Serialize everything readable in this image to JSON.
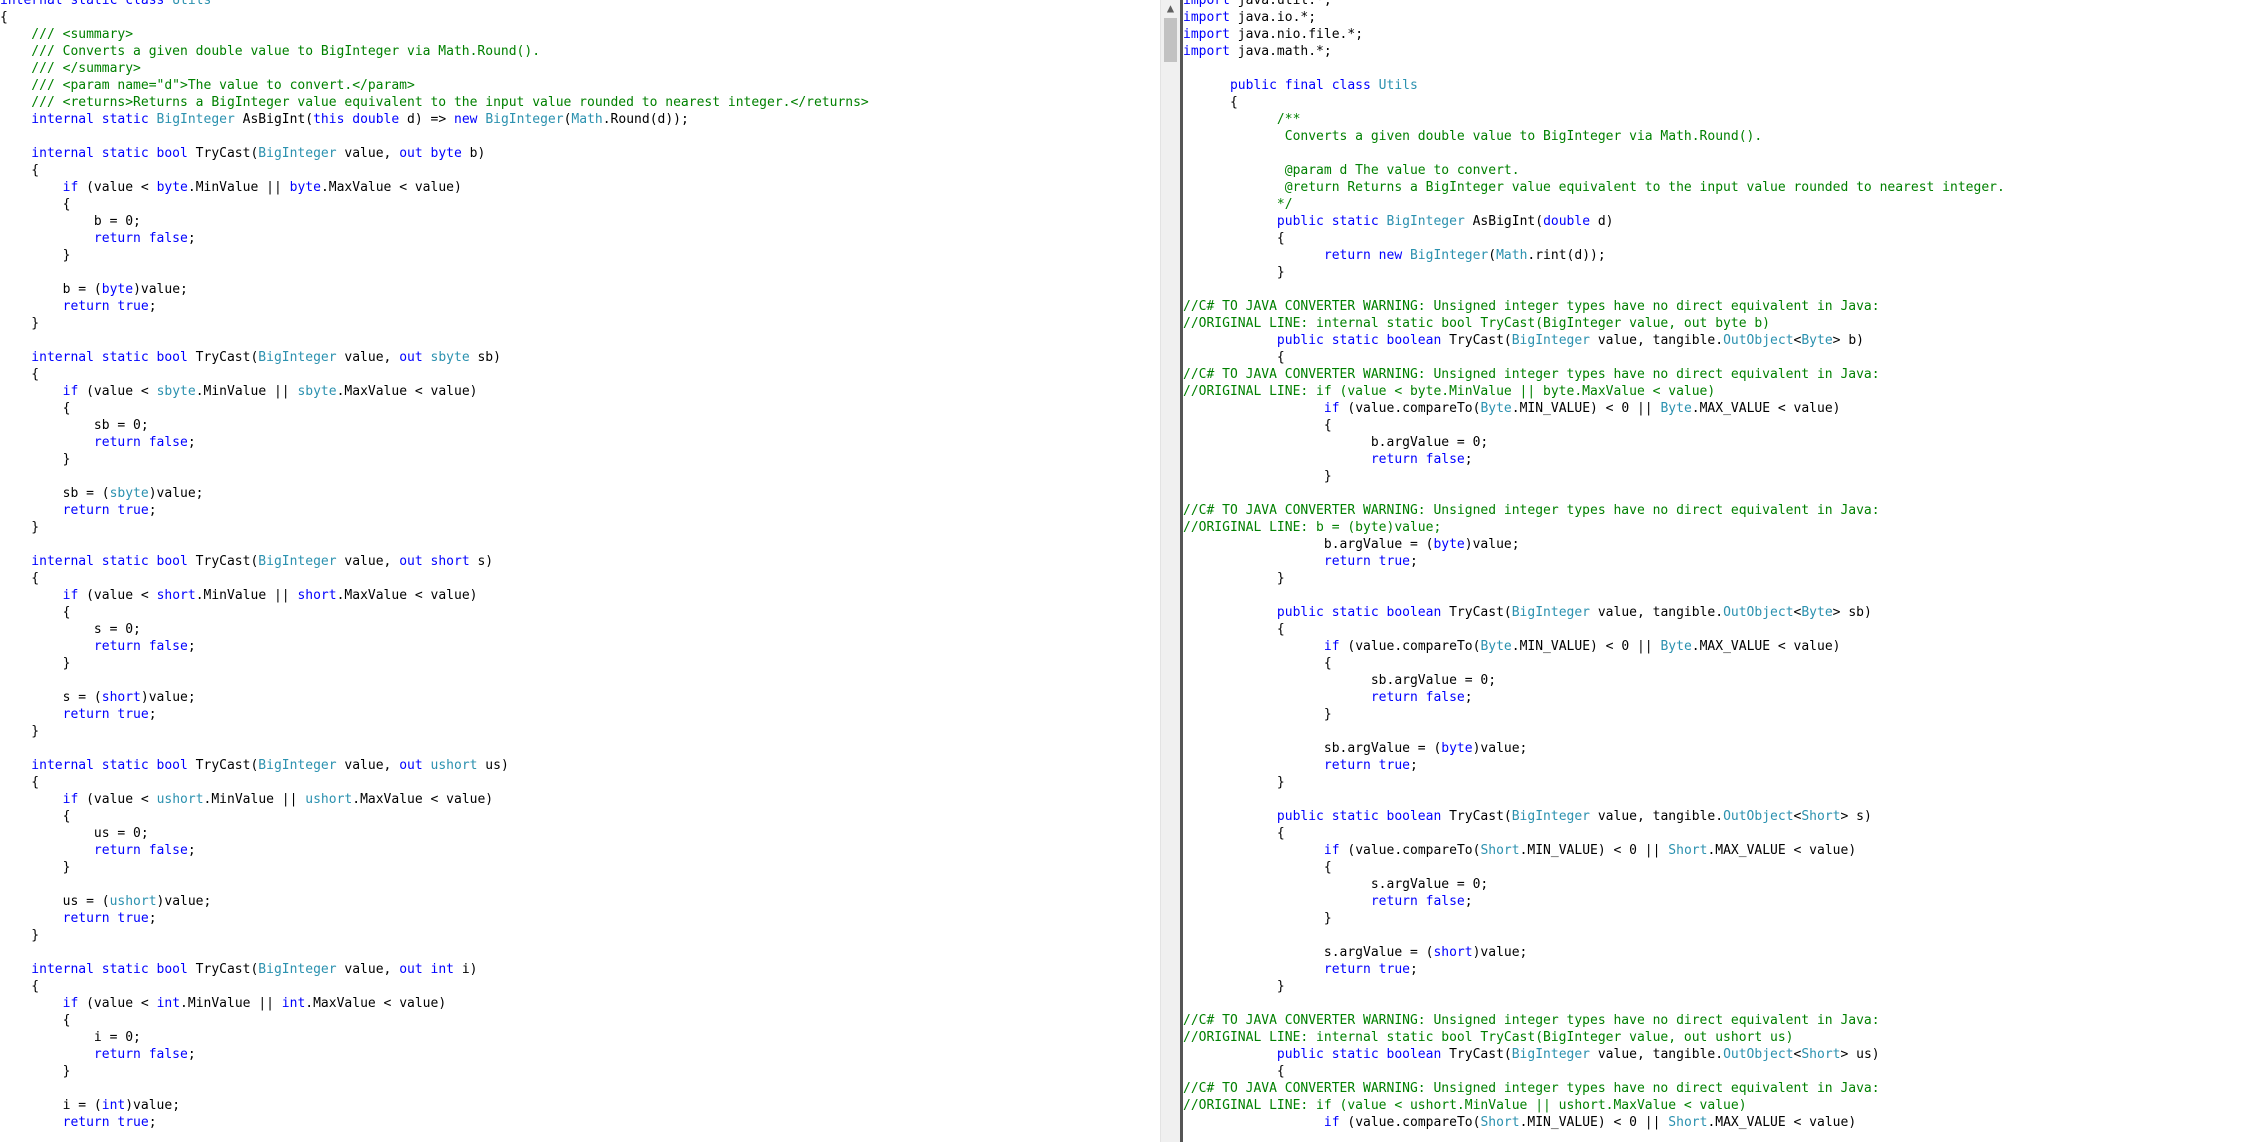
{
  "colors": {
    "background": "#ffffff",
    "text": "#000000",
    "keyword": "#0000ff",
    "type": "#2b91af",
    "comment": "#008000",
    "scrollbar_track": "#f0f0f0",
    "scrollbar_thumb": "#c2c2c2",
    "divider": "#555555"
  },
  "scroll_arrow_icon": "chevron-up-icon",
  "left_pane": {
    "language": "C#",
    "lines": [
      [
        [
          "kw",
          "internal static class "
        ],
        [
          "ty",
          "Utils"
        ]
      ],
      [
        [
          "t",
          "{"
        ]
      ],
      [
        [
          "cm",
          "    /// <summary>"
        ]
      ],
      [
        [
          "cm",
          "    /// Converts a given double value to BigInteger via Math.Round()."
        ]
      ],
      [
        [
          "cm",
          "    /// </summary>"
        ]
      ],
      [
        [
          "cm",
          "    /// <param name=\"d\">The value to convert.</param>"
        ]
      ],
      [
        [
          "cm",
          "    /// <returns>Returns a BigInteger value equivalent to the input value rounded to nearest integer.</returns>"
        ]
      ],
      [
        [
          "kw",
          "    internal static "
        ],
        [
          "ty",
          "BigInteger"
        ],
        [
          "t",
          " AsBigInt("
        ],
        [
          "kw",
          "this double"
        ],
        [
          "t",
          " d) => "
        ],
        [
          "kw",
          "new "
        ],
        [
          "ty",
          "BigInteger"
        ],
        [
          "t",
          "("
        ],
        [
          "ty",
          "Math"
        ],
        [
          "t",
          ".Round(d));"
        ]
      ],
      [],
      [
        [
          "kw",
          "    internal static bool"
        ],
        [
          "t",
          " TryCast("
        ],
        [
          "ty",
          "BigInteger"
        ],
        [
          "t",
          " value, "
        ],
        [
          "kw",
          "out byte"
        ],
        [
          "t",
          " b)"
        ]
      ],
      [
        [
          "t",
          "    {"
        ]
      ],
      [
        [
          "kw",
          "        if"
        ],
        [
          "t",
          " (value < "
        ],
        [
          "kw",
          "byte"
        ],
        [
          "t",
          ".MinValue || "
        ],
        [
          "kw",
          "byte"
        ],
        [
          "t",
          ".MaxValue < value)"
        ]
      ],
      [
        [
          "t",
          "        {"
        ]
      ],
      [
        [
          "t",
          "            b = 0;"
        ]
      ],
      [
        [
          "kw",
          "            return false"
        ],
        [
          "t",
          ";"
        ]
      ],
      [
        [
          "t",
          "        }"
        ]
      ],
      [],
      [
        [
          "t",
          "        b = ("
        ],
        [
          "kw",
          "byte"
        ],
        [
          "t",
          ")value;"
        ]
      ],
      [
        [
          "kw",
          "        return true"
        ],
        [
          "t",
          ";"
        ]
      ],
      [
        [
          "t",
          "    }"
        ]
      ],
      [],
      [
        [
          "kw",
          "    internal static bool"
        ],
        [
          "t",
          " TryCast("
        ],
        [
          "ty",
          "BigInteger"
        ],
        [
          "t",
          " value, "
        ],
        [
          "kw",
          "out "
        ],
        [
          "ty",
          "sbyte"
        ],
        [
          "t",
          " sb)"
        ]
      ],
      [
        [
          "t",
          "    {"
        ]
      ],
      [
        [
          "kw",
          "        if"
        ],
        [
          "t",
          " (value < "
        ],
        [
          "ty",
          "sbyte"
        ],
        [
          "t",
          ".MinValue || "
        ],
        [
          "ty",
          "sbyte"
        ],
        [
          "t",
          ".MaxValue < value)"
        ]
      ],
      [
        [
          "t",
          "        {"
        ]
      ],
      [
        [
          "t",
          "            sb = 0;"
        ]
      ],
      [
        [
          "kw",
          "            return false"
        ],
        [
          "t",
          ";"
        ]
      ],
      [
        [
          "t",
          "        }"
        ]
      ],
      [],
      [
        [
          "t",
          "        sb = ("
        ],
        [
          "ty",
          "sbyte"
        ],
        [
          "t",
          ")value;"
        ]
      ],
      [
        [
          "kw",
          "        return true"
        ],
        [
          "t",
          ";"
        ]
      ],
      [
        [
          "t",
          "    }"
        ]
      ],
      [],
      [
        [
          "kw",
          "    internal static bool"
        ],
        [
          "t",
          " TryCast("
        ],
        [
          "ty",
          "BigInteger"
        ],
        [
          "t",
          " value, "
        ],
        [
          "kw",
          "out short"
        ],
        [
          "t",
          " s)"
        ]
      ],
      [
        [
          "t",
          "    {"
        ]
      ],
      [
        [
          "kw",
          "        if"
        ],
        [
          "t",
          " (value < "
        ],
        [
          "kw",
          "short"
        ],
        [
          "t",
          ".MinValue || "
        ],
        [
          "kw",
          "short"
        ],
        [
          "t",
          ".MaxValue < value)"
        ]
      ],
      [
        [
          "t",
          "        {"
        ]
      ],
      [
        [
          "t",
          "            s = 0;"
        ]
      ],
      [
        [
          "kw",
          "            return false"
        ],
        [
          "t",
          ";"
        ]
      ],
      [
        [
          "t",
          "        }"
        ]
      ],
      [],
      [
        [
          "t",
          "        s = ("
        ],
        [
          "kw",
          "short"
        ],
        [
          "t",
          ")value;"
        ]
      ],
      [
        [
          "kw",
          "        return true"
        ],
        [
          "t",
          ";"
        ]
      ],
      [
        [
          "t",
          "    }"
        ]
      ],
      [],
      [
        [
          "kw",
          "    internal static bool"
        ],
        [
          "t",
          " TryCast("
        ],
        [
          "ty",
          "BigInteger"
        ],
        [
          "t",
          " value, "
        ],
        [
          "kw",
          "out "
        ],
        [
          "ty",
          "ushort"
        ],
        [
          "t",
          " us)"
        ]
      ],
      [
        [
          "t",
          "    {"
        ]
      ],
      [
        [
          "kw",
          "        if"
        ],
        [
          "t",
          " (value < "
        ],
        [
          "ty",
          "ushort"
        ],
        [
          "t",
          ".MinValue || "
        ],
        [
          "ty",
          "ushort"
        ],
        [
          "t",
          ".MaxValue < value)"
        ]
      ],
      [
        [
          "t",
          "        {"
        ]
      ],
      [
        [
          "t",
          "            us = 0;"
        ]
      ],
      [
        [
          "kw",
          "            return false"
        ],
        [
          "t",
          ";"
        ]
      ],
      [
        [
          "t",
          "        }"
        ]
      ],
      [],
      [
        [
          "t",
          "        us = ("
        ],
        [
          "ty",
          "ushort"
        ],
        [
          "t",
          ")value;"
        ]
      ],
      [
        [
          "kw",
          "        return true"
        ],
        [
          "t",
          ";"
        ]
      ],
      [
        [
          "t",
          "    }"
        ]
      ],
      [],
      [
        [
          "kw",
          "    internal static bool"
        ],
        [
          "t",
          " TryCast("
        ],
        [
          "ty",
          "BigInteger"
        ],
        [
          "t",
          " value, "
        ],
        [
          "kw",
          "out int"
        ],
        [
          "t",
          " i)"
        ]
      ],
      [
        [
          "t",
          "    {"
        ]
      ],
      [
        [
          "kw",
          "        if"
        ],
        [
          "t",
          " (value < "
        ],
        [
          "kw",
          "int"
        ],
        [
          "t",
          ".MinValue || "
        ],
        [
          "kw",
          "int"
        ],
        [
          "t",
          ".MaxValue < value)"
        ]
      ],
      [
        [
          "t",
          "        {"
        ]
      ],
      [
        [
          "t",
          "            i = 0;"
        ]
      ],
      [
        [
          "kw",
          "            return false"
        ],
        [
          "t",
          ";"
        ]
      ],
      [
        [
          "t",
          "        }"
        ]
      ],
      [],
      [
        [
          "t",
          "        i = ("
        ],
        [
          "kw",
          "int"
        ],
        [
          "t",
          ")value;"
        ]
      ],
      [
        [
          "kw",
          "        return true"
        ],
        [
          "t",
          ";"
        ]
      ]
    ]
  },
  "right_pane": {
    "language": "Java",
    "lines": [
      [
        [
          "kw",
          "import"
        ],
        [
          "t",
          " java.util.*;"
        ]
      ],
      [
        [
          "kw",
          "import"
        ],
        [
          "t",
          " java.io.*;"
        ]
      ],
      [
        [
          "kw",
          "import"
        ],
        [
          "t",
          " java.nio.file.*;"
        ]
      ],
      [
        [
          "kw",
          "import"
        ],
        [
          "t",
          " java.math.*;"
        ]
      ],
      [],
      [
        [
          "kw",
          "      public final class "
        ],
        [
          "ty",
          "Utils"
        ]
      ],
      [
        [
          "t",
          "      {"
        ]
      ],
      [
        [
          "cm",
          "            /**"
        ]
      ],
      [
        [
          "cm",
          "             Converts a given double value to BigInteger via Math.Round()."
        ]
      ],
      [],
      [
        [
          "cm",
          "             @param d The value to convert."
        ]
      ],
      [
        [
          "cm",
          "             @return Returns a BigInteger value equivalent to the input value rounded to nearest integer."
        ]
      ],
      [
        [
          "cm",
          "            */"
        ]
      ],
      [
        [
          "kw",
          "            public static "
        ],
        [
          "ty",
          "BigInteger"
        ],
        [
          "t",
          " AsBigInt("
        ],
        [
          "kw",
          "double"
        ],
        [
          "t",
          " d)"
        ]
      ],
      [
        [
          "t",
          "            {"
        ]
      ],
      [
        [
          "kw",
          "                  return new "
        ],
        [
          "ty",
          "BigInteger"
        ],
        [
          "t",
          "("
        ],
        [
          "ty",
          "Math"
        ],
        [
          "t",
          ".rint(d));"
        ]
      ],
      [
        [
          "t",
          "            }"
        ]
      ],
      [],
      [
        [
          "cm",
          "//C# TO JAVA CONVERTER WARNING: Unsigned integer types have no direct equivalent in Java:"
        ]
      ],
      [
        [
          "cm",
          "//ORIGINAL LINE: internal static bool TryCast(BigInteger value, out byte b)"
        ]
      ],
      [
        [
          "kw",
          "            public static boolean"
        ],
        [
          "t",
          " TryCast("
        ],
        [
          "ty",
          "BigInteger"
        ],
        [
          "t",
          " value, tangible."
        ],
        [
          "ty",
          "OutObject"
        ],
        [
          "t",
          "<"
        ],
        [
          "ty",
          "Byte"
        ],
        [
          "t",
          "> b)"
        ]
      ],
      [
        [
          "t",
          "            {"
        ]
      ],
      [
        [
          "cm",
          "//C# TO JAVA CONVERTER WARNING: Unsigned integer types have no direct equivalent in Java:"
        ]
      ],
      [
        [
          "cm",
          "//ORIGINAL LINE: if (value < byte.MinValue || byte.MaxValue < value)"
        ]
      ],
      [
        [
          "kw",
          "                  if"
        ],
        [
          "t",
          " (value.compareTo("
        ],
        [
          "ty",
          "Byte"
        ],
        [
          "t",
          ".MIN_VALUE) < 0 || "
        ],
        [
          "ty",
          "Byte"
        ],
        [
          "t",
          ".MAX_VALUE < value)"
        ]
      ],
      [
        [
          "t",
          "                  {"
        ]
      ],
      [
        [
          "t",
          "                        b.argValue = 0;"
        ]
      ],
      [
        [
          "kw",
          "                        return false"
        ],
        [
          "t",
          ";"
        ]
      ],
      [
        [
          "t",
          "                  }"
        ]
      ],
      [],
      [
        [
          "cm",
          "//C# TO JAVA CONVERTER WARNING: Unsigned integer types have no direct equivalent in Java:"
        ]
      ],
      [
        [
          "cm",
          "//ORIGINAL LINE: b = (byte)value;"
        ]
      ],
      [
        [
          "t",
          "                  b.argValue = ("
        ],
        [
          "kw",
          "byte"
        ],
        [
          "t",
          ")value;"
        ]
      ],
      [
        [
          "kw",
          "                  return true"
        ],
        [
          "t",
          ";"
        ]
      ],
      [
        [
          "t",
          "            }"
        ]
      ],
      [],
      [
        [
          "kw",
          "            public static boolean"
        ],
        [
          "t",
          " TryCast("
        ],
        [
          "ty",
          "BigInteger"
        ],
        [
          "t",
          " value, tangible."
        ],
        [
          "ty",
          "OutObject"
        ],
        [
          "t",
          "<"
        ],
        [
          "ty",
          "Byte"
        ],
        [
          "t",
          "> sb)"
        ]
      ],
      [
        [
          "t",
          "            {"
        ]
      ],
      [
        [
          "kw",
          "                  if"
        ],
        [
          "t",
          " (value.compareTo("
        ],
        [
          "ty",
          "Byte"
        ],
        [
          "t",
          ".MIN_VALUE) < 0 || "
        ],
        [
          "ty",
          "Byte"
        ],
        [
          "t",
          ".MAX_VALUE < value)"
        ]
      ],
      [
        [
          "t",
          "                  {"
        ]
      ],
      [
        [
          "t",
          "                        sb.argValue = 0;"
        ]
      ],
      [
        [
          "kw",
          "                        return false"
        ],
        [
          "t",
          ";"
        ]
      ],
      [
        [
          "t",
          "                  }"
        ]
      ],
      [],
      [
        [
          "t",
          "                  sb.argValue = ("
        ],
        [
          "kw",
          "byte"
        ],
        [
          "t",
          ")value;"
        ]
      ],
      [
        [
          "kw",
          "                  return true"
        ],
        [
          "t",
          ";"
        ]
      ],
      [
        [
          "t",
          "            }"
        ]
      ],
      [],
      [
        [
          "kw",
          "            public static boolean"
        ],
        [
          "t",
          " TryCast("
        ],
        [
          "ty",
          "BigInteger"
        ],
        [
          "t",
          " value, tangible."
        ],
        [
          "ty",
          "OutObject"
        ],
        [
          "t",
          "<"
        ],
        [
          "ty",
          "Short"
        ],
        [
          "t",
          "> s)"
        ]
      ],
      [
        [
          "t",
          "            {"
        ]
      ],
      [
        [
          "kw",
          "                  if"
        ],
        [
          "t",
          " (value.compareTo("
        ],
        [
          "ty",
          "Short"
        ],
        [
          "t",
          ".MIN_VALUE) < 0 || "
        ],
        [
          "ty",
          "Short"
        ],
        [
          "t",
          ".MAX_VALUE < value)"
        ]
      ],
      [
        [
          "t",
          "                  {"
        ]
      ],
      [
        [
          "t",
          "                        s.argValue = 0;"
        ]
      ],
      [
        [
          "kw",
          "                        return false"
        ],
        [
          "t",
          ";"
        ]
      ],
      [
        [
          "t",
          "                  }"
        ]
      ],
      [],
      [
        [
          "t",
          "                  s.argValue = ("
        ],
        [
          "kw",
          "short"
        ],
        [
          "t",
          ")value;"
        ]
      ],
      [
        [
          "kw",
          "                  return true"
        ],
        [
          "t",
          ";"
        ]
      ],
      [
        [
          "t",
          "            }"
        ]
      ],
      [],
      [
        [
          "cm",
          "//C# TO JAVA CONVERTER WARNING: Unsigned integer types have no direct equivalent in Java:"
        ]
      ],
      [
        [
          "cm",
          "//ORIGINAL LINE: internal static bool TryCast(BigInteger value, out ushort us)"
        ]
      ],
      [
        [
          "kw",
          "            public static boolean"
        ],
        [
          "t",
          " TryCast("
        ],
        [
          "ty",
          "BigInteger"
        ],
        [
          "t",
          " value, tangible."
        ],
        [
          "ty",
          "OutObject"
        ],
        [
          "t",
          "<"
        ],
        [
          "ty",
          "Short"
        ],
        [
          "t",
          "> us)"
        ]
      ],
      [
        [
          "t",
          "            {"
        ]
      ],
      [
        [
          "cm",
          "//C# TO JAVA CONVERTER WARNING: Unsigned integer types have no direct equivalent in Java:"
        ]
      ],
      [
        [
          "cm",
          "//ORIGINAL LINE: if (value < ushort.MinValue || ushort.MaxValue < value)"
        ]
      ],
      [
        [
          "kw",
          "                  if"
        ],
        [
          "t",
          " (value.compareTo("
        ],
        [
          "ty",
          "Short"
        ],
        [
          "t",
          ".MIN_VALUE) < 0 || "
        ],
        [
          "ty",
          "Short"
        ],
        [
          "t",
          ".MAX_VALUE < value)"
        ]
      ]
    ]
  }
}
